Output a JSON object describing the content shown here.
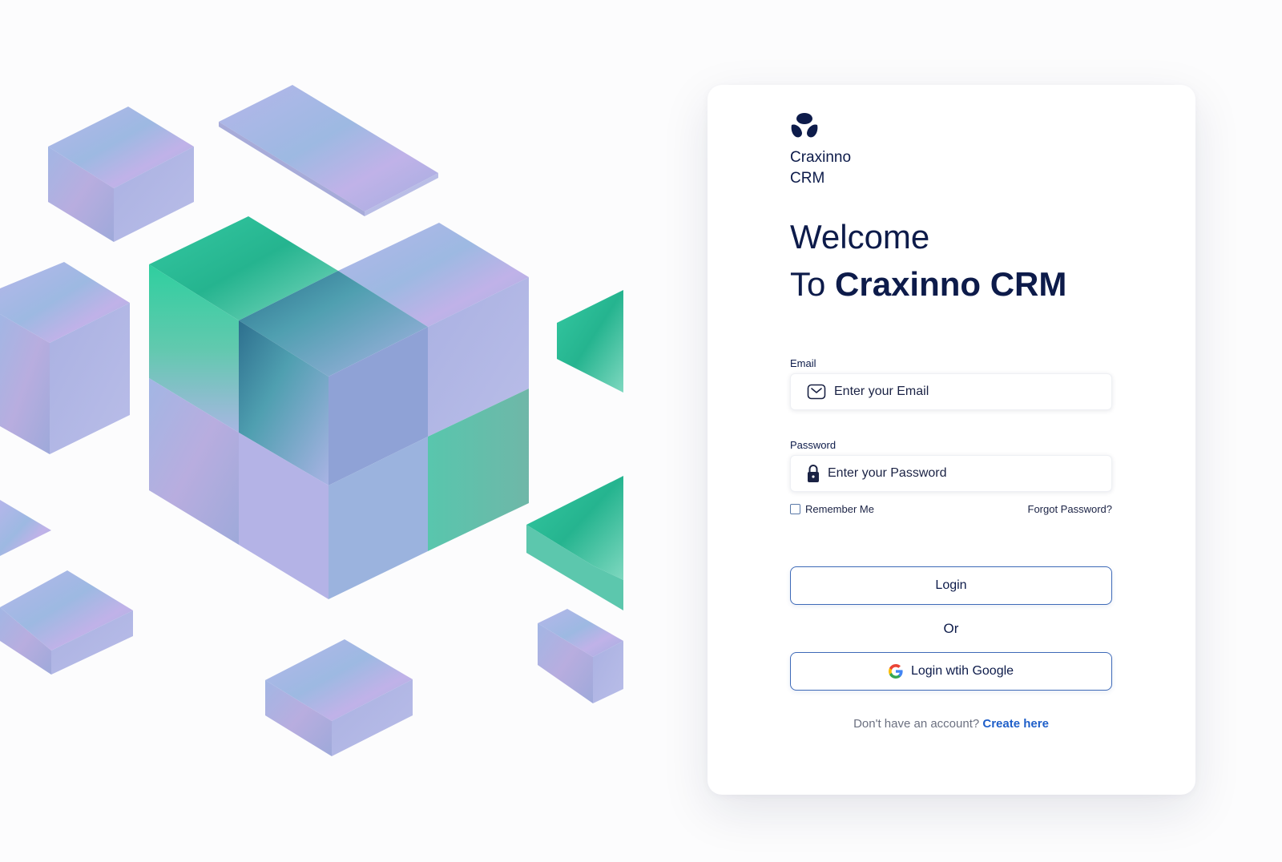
{
  "brand": {
    "name": "Craxinno CRM",
    "logo_icon": "craxinno-logo-icon"
  },
  "welcome": {
    "line1": "Welcome",
    "line2_prefix": "To ",
    "line2_bold": "Craxinno CRM"
  },
  "email": {
    "label": "Email",
    "placeholder": "Enter your Email",
    "value": "",
    "icon": "mail-icon"
  },
  "password": {
    "label": "Password",
    "placeholder": "Enter your Password",
    "value": "",
    "icon": "lock-icon"
  },
  "options": {
    "remember_label": "Remember Me",
    "remember_checked": false,
    "forgot_label": "Forgot Password?"
  },
  "buttons": {
    "login_label": "Login",
    "or_label": "Or",
    "google_label": "Login wtih Google",
    "google_icon": "google-icon"
  },
  "signup": {
    "prompt": "Don't have an account?",
    "link_label": "Create here"
  },
  "colors": {
    "primary_text": "#0d1b4a",
    "button_border": "#3e6ab8",
    "link": "#1f5fc9",
    "cube_violet": "#a9b0e0",
    "cube_teal": "#2ec9a0"
  }
}
